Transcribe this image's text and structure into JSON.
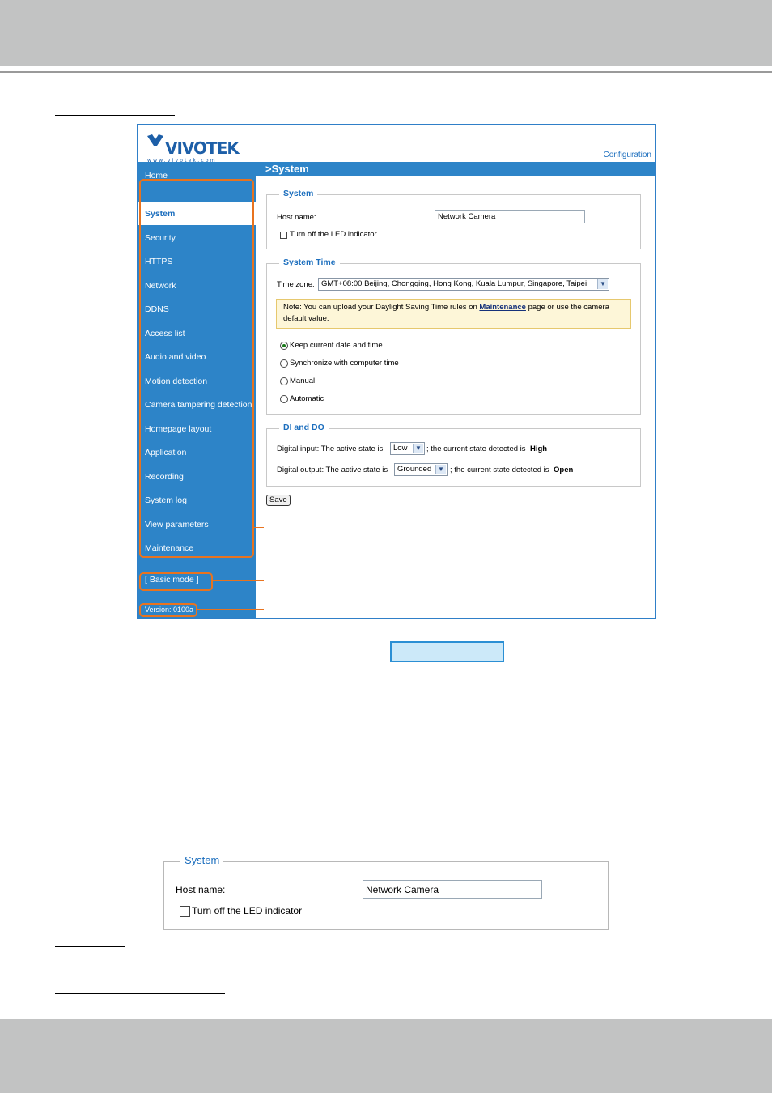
{
  "brand": {
    "name": "VIVOTEK",
    "url": "www.vivotek.com"
  },
  "header": {
    "config_link": "Configuration",
    "page_title": ">System"
  },
  "sidebar": {
    "items": [
      {
        "label": "Home"
      },
      {
        "label": "System",
        "active": true
      },
      {
        "label": "Security"
      },
      {
        "label": "HTTPS"
      },
      {
        "label": "Network"
      },
      {
        "label": "DDNS"
      },
      {
        "label": "Access list"
      },
      {
        "label": "Audio and video"
      },
      {
        "label": "Motion detection"
      },
      {
        "label": "Camera tampering detection"
      },
      {
        "label": "Homepage layout"
      },
      {
        "label": "Application"
      },
      {
        "label": "Recording"
      },
      {
        "label": "System log"
      },
      {
        "label": "View parameters"
      },
      {
        "label": "Maintenance"
      }
    ],
    "basic_mode": "[ Basic mode ]",
    "version": "Version: 0100a"
  },
  "system": {
    "legend": "System",
    "host_label": "Host name:",
    "host_value": "Network Camera",
    "led_label": "Turn off the LED indicator"
  },
  "system_time": {
    "legend": "System Time",
    "tz_label": "Time zone:",
    "tz_value": "GMT+08:00 Beijing, Chongqing, Hong Kong, Kuala Lumpur, Singapore, Taipei",
    "note_prefix": "Note: You can upload your Daylight Saving Time rules on ",
    "note_link": "Maintenance",
    "note_suffix": " page or use the camera",
    "note_line2": "default value.",
    "options": [
      {
        "label": "Keep current date and time",
        "selected": true
      },
      {
        "label": "Synchronize with computer time"
      },
      {
        "label": "Manual"
      },
      {
        "label": "Automatic"
      }
    ]
  },
  "dido": {
    "legend": "DI and DO",
    "di_prefix": "Digital input: The active state is",
    "di_value": "Low",
    "di_suffix": "; the current state detected is",
    "di_state": "High",
    "do_prefix": "Digital output: The active state is",
    "do_value": "Grounded",
    "do_suffix": "; the current state detected is",
    "do_state": "Open"
  },
  "save_label": "Save",
  "colors": {
    "accent": "#2d84c8",
    "highlight": "#e8731f",
    "link": "#1d6fbe"
  }
}
